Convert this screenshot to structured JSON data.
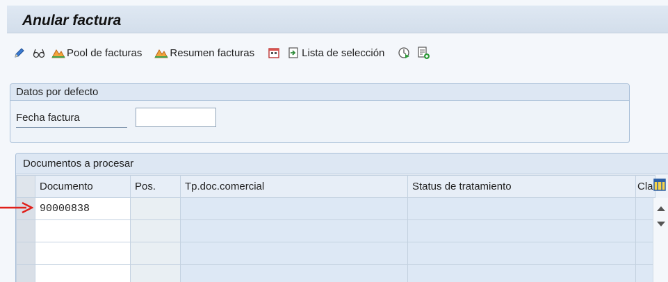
{
  "window": {
    "title": "Anular factura"
  },
  "toolbar": {
    "icons": [
      "pencil-icon",
      "glasses-icon"
    ],
    "pool_label": "Pool de facturas",
    "resumen_label": "Resumen facturas",
    "lista_label": "Lista de selección"
  },
  "datos_por_defecto": {
    "header": "Datos por defecto",
    "fecha_label": "Fecha factura",
    "fecha_value": ""
  },
  "documentos": {
    "header": "Documentos a procesar",
    "columns": [
      "Documento",
      "Pos.",
      "Tp.doc.comercial",
      "Status de tratamiento",
      "Cla"
    ],
    "rows": [
      [
        "90000838",
        "",
        "",
        "",
        ""
      ],
      [
        "",
        "",
        "",
        "",
        ""
      ],
      [
        "",
        "",
        "",
        "",
        ""
      ],
      [
        "",
        "",
        "",
        "",
        ""
      ]
    ]
  },
  "colors": {
    "accent_arrow": "#e0201b",
    "header_bg": "#dde7f3"
  }
}
